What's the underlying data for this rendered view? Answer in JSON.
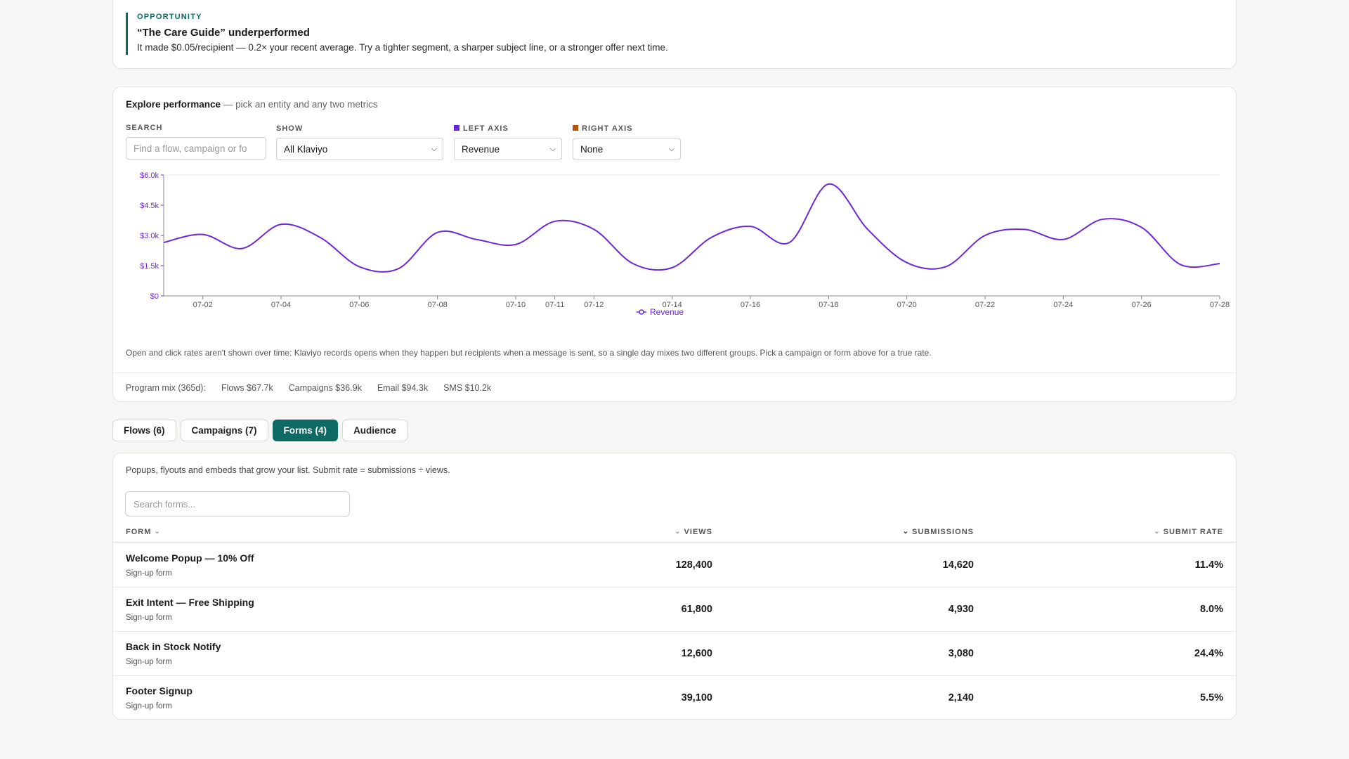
{
  "opportunity": {
    "kicker": "OPPORTUNITY",
    "title": "“The Care Guide” underperformed",
    "body": "It made $0.05/recipient — 0.2× your recent average. Try a tighter segment, a sharper subject line, or a stronger offer next time."
  },
  "explore": {
    "title": "Explore performance",
    "subtitle": "— pick an entity and any two metrics",
    "search_label": "SEARCH",
    "search_placeholder": "Find a flow, campaign or fo",
    "show_label": "SHOW",
    "show_value": "All Klaviyo",
    "left_axis_label": "LEFT AXIS",
    "left_axis_value": "Revenue",
    "right_axis_label": "RIGHT AXIS",
    "right_axis_value": "None",
    "left_color": "#6d28d9",
    "right_color": "#b45309",
    "note": "Open and click rates aren't shown over time: Klaviyo records opens when they happen but recipients when a message is sent, so a single day mixes two different groups. Pick a campaign or form above for a true rate.",
    "mix": {
      "label": "Program mix (365d):",
      "flows": "Flows $67.7k",
      "campaigns": "Campaigns $36.9k",
      "email": "Email $94.3k",
      "sms": "SMS $10.2k"
    }
  },
  "chart_data": {
    "type": "line",
    "x": [
      "07-01",
      "07-02",
      "07-03",
      "07-04",
      "07-05",
      "07-06",
      "07-07",
      "07-08",
      "07-09",
      "07-10",
      "07-11",
      "07-12",
      "07-13",
      "07-14",
      "07-15",
      "07-16",
      "07-17",
      "07-18",
      "07-19",
      "07-20",
      "07-21",
      "07-22",
      "07-23",
      "07-24",
      "07-25",
      "07-26",
      "07-27",
      "07-28"
    ],
    "x_ticks": [
      "07-02",
      "07-04",
      "07-06",
      "07-08",
      "07-10",
      "07-11",
      "07-12",
      "07-14",
      "07-16",
      "07-18",
      "07-20",
      "07-22",
      "07-24",
      "07-26",
      "07-28"
    ],
    "series": [
      {
        "name": "Revenue",
        "color": "#6d28d9",
        "values": [
          2650,
          3050,
          2350,
          3550,
          2900,
          1450,
          1350,
          3150,
          2800,
          2550,
          3700,
          3300,
          1600,
          1400,
          2900,
          3450,
          2650,
          5550,
          3300,
          1650,
          1450,
          3000,
          3300,
          2800,
          3800,
          3400,
          1550,
          1600
        ]
      }
    ],
    "y_ticks": [
      "$0",
      "$1.5k",
      "$3.0k",
      "$4.5k",
      "$6.0k"
    ],
    "ylim": [
      0,
      6000
    ],
    "legend": "bottom-center"
  },
  "tabs": [
    {
      "label": "Flows (6)",
      "active": false
    },
    {
      "label": "Campaigns (7)",
      "active": false
    },
    {
      "label": "Forms (4)",
      "active": true
    },
    {
      "label": "Audience",
      "active": false
    }
  ],
  "forms": {
    "description": "Popups, flyouts and embeds that grow your list. Submit rate = submissions ÷ views.",
    "search_placeholder": "Search forms...",
    "columns": {
      "form": "FORM",
      "views": "VIEWS",
      "submissions": "SUBMISSIONS",
      "rate": "SUBMIT RATE"
    },
    "rows": [
      {
        "name": "Welcome Popup — 10% Off",
        "type": "Sign-up form",
        "views": "128,400",
        "submissions": "14,620",
        "rate": "11.4%"
      },
      {
        "name": "Exit Intent — Free Shipping",
        "type": "Sign-up form",
        "views": "61,800",
        "submissions": "4,930",
        "rate": "8.0%"
      },
      {
        "name": "Back in Stock Notify",
        "type": "Sign-up form",
        "views": "12,600",
        "submissions": "3,080",
        "rate": "24.4%"
      },
      {
        "name": "Footer Signup",
        "type": "Sign-up form",
        "views": "39,100",
        "submissions": "2,140",
        "rate": "5.5%"
      }
    ]
  }
}
